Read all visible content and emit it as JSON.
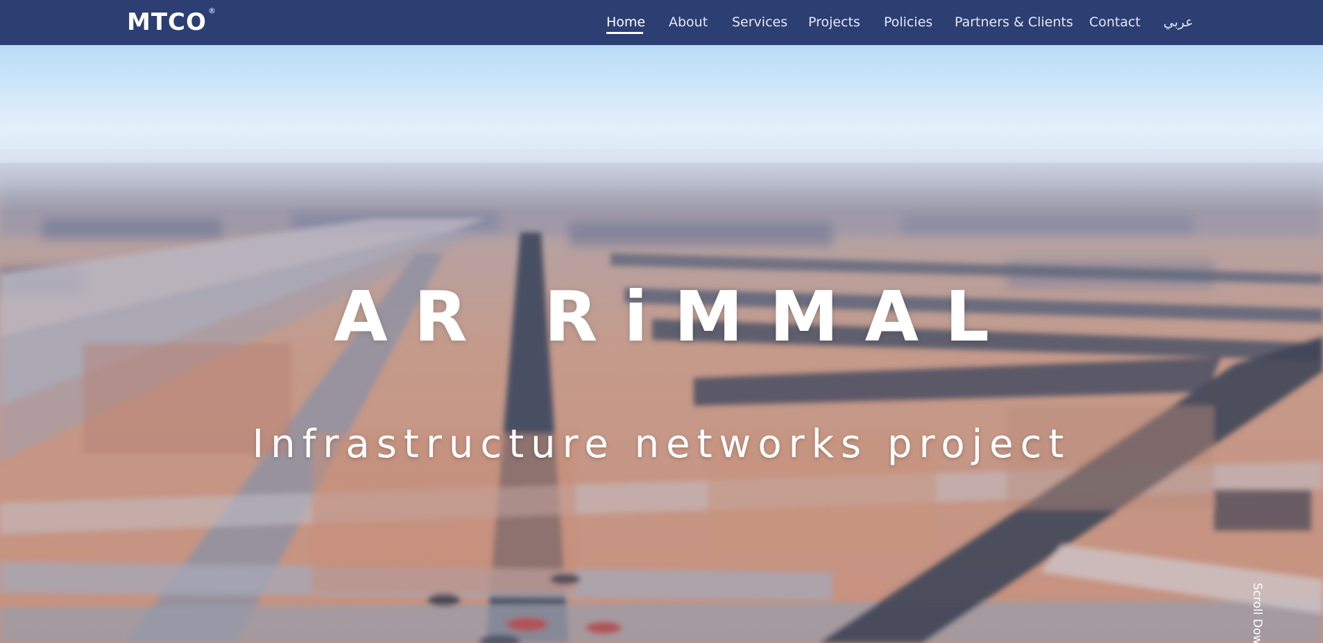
{
  "navbar": {
    "logo_text": "MTCO",
    "logo_mark": "®",
    "links": [
      {
        "label": "Home",
        "active": true
      },
      {
        "label": "About"
      },
      {
        "label": "Services"
      },
      {
        "label": "Projects"
      },
      {
        "label": "Policies"
      },
      {
        "label": "Partners & Clients"
      },
      {
        "label": "Contact"
      },
      {
        "label": "عربي"
      }
    ]
  },
  "hero": {
    "title": "AR RiMMAL",
    "subtitle": "Infrastructure networks project",
    "scroll_label": "Scroll Dow"
  },
  "colors": {
    "navbar_bg": "#2c3e72",
    "text": "#ffffff"
  }
}
